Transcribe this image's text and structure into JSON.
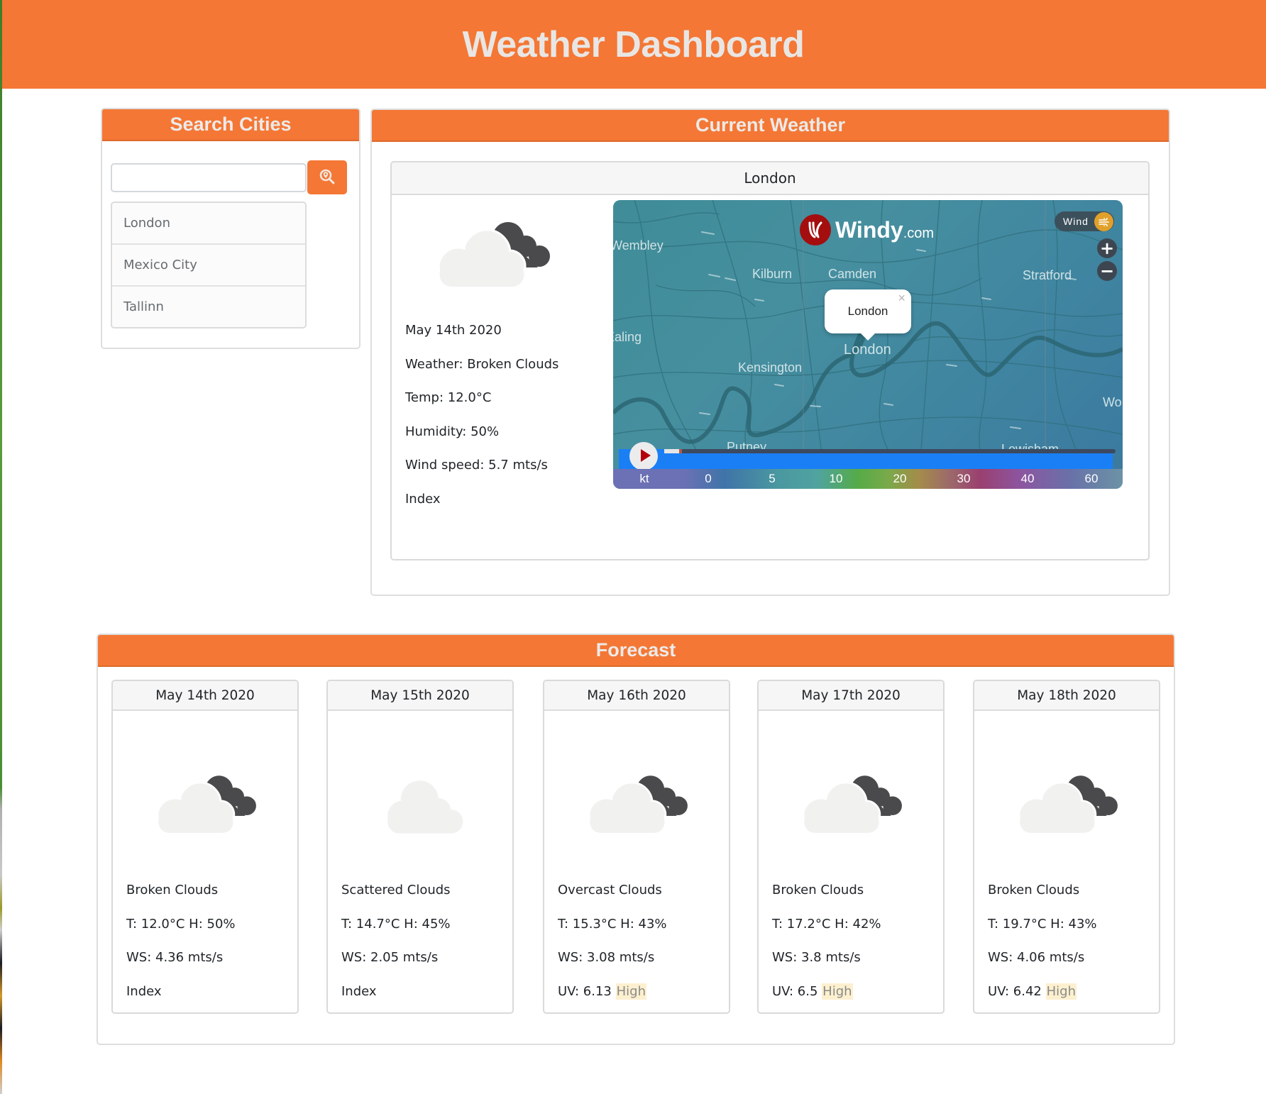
{
  "header": {
    "title": "Weather Dashboard"
  },
  "search": {
    "title": "Search Cities",
    "input_value": "",
    "input_placeholder": "",
    "button_icon": "search-location-icon",
    "cities": [
      "London",
      "Mexico City",
      "Tallinn"
    ]
  },
  "current": {
    "title": "Current Weather",
    "city": "London",
    "icon": "broken-clouds-icon",
    "date": "May 14th 2020",
    "weather": "Weather: Broken Clouds",
    "temp": "Temp: 12.0°C",
    "humidity": "Humidity: 50%",
    "wind": "Wind speed: 5.7 mts/s",
    "index": "Index"
  },
  "map": {
    "brand": "Windy",
    "brand_suffix": ".com",
    "layer": "Wind",
    "zoom_in": "+",
    "zoom_out": "−",
    "popup": "London",
    "popup_close": "×",
    "timeline_progress": 0.04,
    "labels": {
      "wembley": "Wembley",
      "kilburn": "Kilburn",
      "camden": "Camden",
      "stratford": "Stratford",
      "ealing": "Ealing",
      "london": "London",
      "kensington": "Kensington",
      "wo": "Wo",
      "putney": "Putney",
      "lewisham": "Lewisham"
    },
    "scale_unit": "kt",
    "scale_values": [
      "0",
      "5",
      "10",
      "20",
      "30",
      "40",
      "60"
    ]
  },
  "forecast": {
    "title": "Forecast",
    "days": [
      {
        "date": "May 14th 2020",
        "icon": "broken-clouds-icon",
        "desc": "Broken Clouds",
        "th": "T: 12.0°C H: 50%",
        "ws": "WS: 4.36 mts/s",
        "uv": "Index",
        "uv_level": ""
      },
      {
        "date": "May 15th 2020",
        "icon": "scattered-clouds-icon",
        "desc": "Scattered Clouds",
        "th": "T: 14.7°C H: 45%",
        "ws": "WS: 2.05 mts/s",
        "uv": "Index",
        "uv_level": ""
      },
      {
        "date": "May 16th 2020",
        "icon": "broken-clouds-icon",
        "desc": "Overcast Clouds",
        "th": "T: 15.3°C H: 43%",
        "ws": "WS: 3.08 mts/s",
        "uv": "UV: 6.13",
        "uv_level": "High"
      },
      {
        "date": "May 17th 2020",
        "icon": "broken-clouds-icon",
        "desc": "Broken Clouds",
        "th": "T: 17.2°C H: 42%",
        "ws": "WS: 3.8 mts/s",
        "uv": "UV: 6.5",
        "uv_level": "High"
      },
      {
        "date": "May 18th 2020",
        "icon": "broken-clouds-icon",
        "desc": "Broken Clouds",
        "th": "T: 19.7°C H: 43%",
        "ws": "WS: 4.06 mts/s",
        "uv": "UV: 6.42",
        "uv_level": "High"
      }
    ]
  },
  "colors": {
    "brand": "#F47735",
    "header_text": "#E8E6E4",
    "uv_high_bg": "#FDF0CF",
    "map_water": "#3F8C98",
    "windy_red": "#A50E0E"
  }
}
